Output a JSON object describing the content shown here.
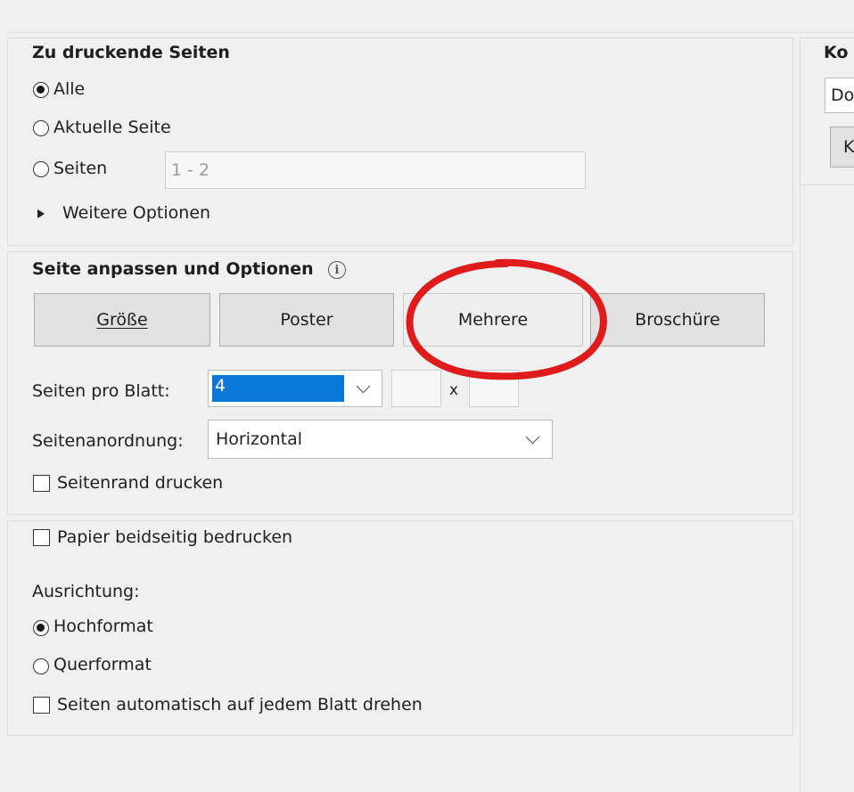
{
  "pages_section": {
    "title": "Zu druckende Seiten",
    "options": [
      {
        "label": "Alle",
        "checked": true
      },
      {
        "label": "Aktuelle Seite",
        "checked": false
      },
      {
        "label": "Seiten",
        "checked": false
      }
    ],
    "pages_input_value": "1 - 2",
    "more_options_label": "Weitere Optionen"
  },
  "fit_section": {
    "title": "Seite anpassen und Optionen",
    "info_icon": "info-icon",
    "buttons": {
      "size": "Größe",
      "poster": "Poster",
      "multiple": "Mehrere",
      "booklet": "Broschüre"
    },
    "pages_per_sheet_label": "Seiten pro Blatt:",
    "pages_per_sheet_value": "4",
    "x_label": "x",
    "page_order_label": "Seitenanordnung:",
    "page_order_value": "Horizontal",
    "print_border_label": "Seitenrand drucken"
  },
  "paper_section": {
    "duplex_label": "Papier beidseitig bedrucken",
    "orientation_label": "Ausrichtung:",
    "orientation_options": [
      {
        "label": "Hochformat",
        "checked": true
      },
      {
        "label": "Querformat",
        "checked": false
      }
    ],
    "auto_rotate_label": "Seiten automatisch auf jedem Blatt drehen"
  },
  "right_panel": {
    "title_fragment": "Ko",
    "dropdown_fragment": "Do",
    "button_fragment": "K"
  },
  "annotation": {
    "color": "#e01b1b"
  }
}
